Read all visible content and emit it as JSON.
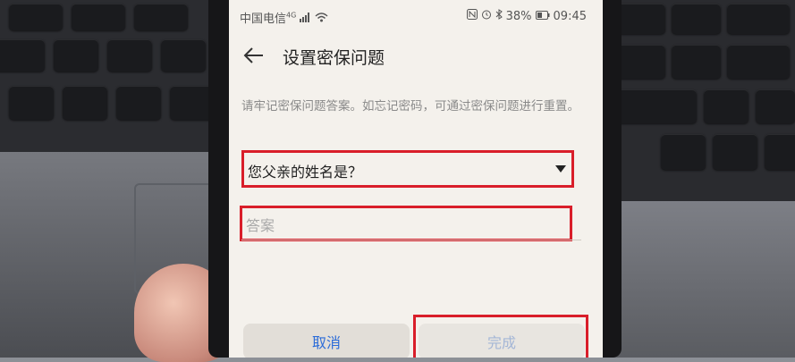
{
  "status_bar": {
    "carrier": "中国电信",
    "network": "4G",
    "battery": "38%",
    "time": "09:45",
    "icons": [
      "signal-icon",
      "wifi-icon",
      "nfc-icon",
      "alarm-icon",
      "bluetooth-icon",
      "battery-icon"
    ]
  },
  "header": {
    "title": "设置密保问题",
    "back_icon": "back-arrow-icon"
  },
  "hint_text": "请牢记密保问题答案。如忘记密码，可通过密保问题进行重置。",
  "question_select": {
    "selected": "您父亲的姓名是？"
  },
  "answer_field": {
    "placeholder": "答案",
    "value": ""
  },
  "buttons": {
    "cancel": "取消",
    "done": "完成"
  },
  "colors": {
    "highlight_box": "#d91e2a",
    "cancel_text": "#2c6cd8",
    "done_disabled_text": "#a4b6d6",
    "screen_bg": "#f4f1ec"
  }
}
